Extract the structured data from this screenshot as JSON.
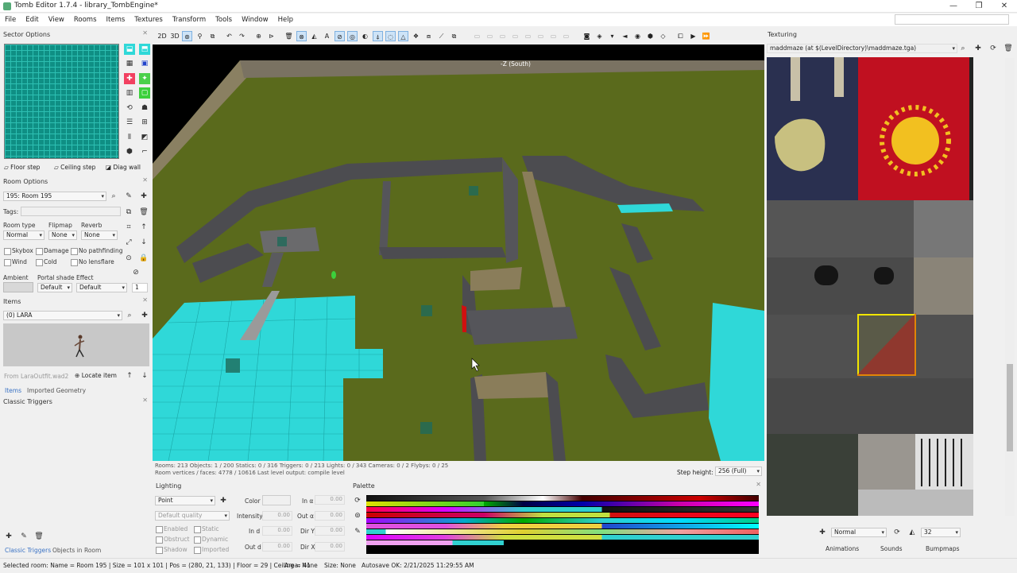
{
  "window": {
    "title": "Tomb Editor 1.7.4 - library_TombEngine*",
    "minimize": "—",
    "maximize": "❐",
    "close": "✕"
  },
  "menu": [
    "File",
    "Edit",
    "View",
    "Rooms",
    "Items",
    "Textures",
    "Transform",
    "Tools",
    "Window",
    "Help"
  ],
  "sector_options": {
    "title": "Sector Options",
    "floor_step": "Floor step",
    "ceiling_step": "Ceiling step",
    "diag_wall": "Diag wall"
  },
  "room_options": {
    "title": "Room Options",
    "room_selector": "195: Room 195",
    "tags_label": "Tags:",
    "room_type_label": "Room type",
    "room_type_value": "Normal",
    "flipmap_label": "Flipmap",
    "flipmap_value": "None",
    "reverb_label": "Reverb",
    "reverb_value": "None",
    "skybox": "Skybox",
    "damage": "Damage",
    "no_pathfinding": "No pathfinding",
    "wind": "Wind",
    "cold": "Cold",
    "no_lensflare": "No lensflare",
    "ambient_label": "Ambient",
    "portal_shade_label": "Portal shade",
    "portal_shade_value": "Default",
    "effect_label": "Effect",
    "effect_value": "Default",
    "effect_strength": "1"
  },
  "items_panel": {
    "title": "Items",
    "selected": "(0) LARA",
    "source": "From LaraOutfit.wad2",
    "locate": "Locate item",
    "tab_items": "Items",
    "tab_imported": "Imported Geometry"
  },
  "classic_triggers": {
    "title": "Classic Triggers",
    "tab_triggers": "Classic Triggers",
    "tab_objects": "Objects in Room"
  },
  "viewport": {
    "direction_label": "-Z (South)",
    "status_line1": "Rooms: 213  Objects: 1 / 200  Statics: 0 / 316  Triggers: 0 / 213  Lights: 0 / 343  Cameras: 0 / 2  Flybys: 0 / 25",
    "status_line2": "Room vertices / faces: 4778 / 10616  Last level output: compile level",
    "step_height_label": "Step height:",
    "step_height_value": "256 (Full)",
    "toolbar_2d": "2D",
    "toolbar_3d": "3D",
    "toolbar_a": "A"
  },
  "lighting": {
    "title": "Lighting",
    "type": "Point",
    "quality": "Default quality",
    "color_label": "Color",
    "intensity_label": "Intensity",
    "in_d_label": "In d",
    "out_d_label": "Out d",
    "in_a_label": "In α",
    "out_a_label": "Out α",
    "dir_y_label": "Dir Y",
    "dir_x_label": "Dir X",
    "enabled": "Enabled",
    "obstruct": "Obstruct",
    "shadow": "Shadow",
    "static": "Static",
    "dynamic": "Dynamic",
    "imported": "Imported",
    "zero": "0.00"
  },
  "palette": {
    "title": "Palette"
  },
  "texturing": {
    "title": "Texturing",
    "file": "maddmaze (at $(LevelDirectory)\\maddmaze.tga)",
    "blend_mode": "Normal",
    "tile_size": "32",
    "tab_animations": "Animations",
    "tab_sounds": "Sounds",
    "tab_bumpmaps": "Bumpmaps"
  },
  "statusbar": {
    "selected_room": "Selected room: Name = Room 195 | Size = 101 x 101 | Pos = (280, 21, 133) | Floor = 29 | Ceiling = 41",
    "area": "Area: None",
    "size": "Size: None",
    "autosave": "Autosave OK: 2/21/2025 11:29:55 AM"
  },
  "colors": {
    "accent_cyan": "#2fd8d8",
    "grass": "#5a6a1c",
    "selection_cyan": "#2fd1d1",
    "texture_yellow": "#f2e600",
    "texture_red": "#d01010"
  }
}
